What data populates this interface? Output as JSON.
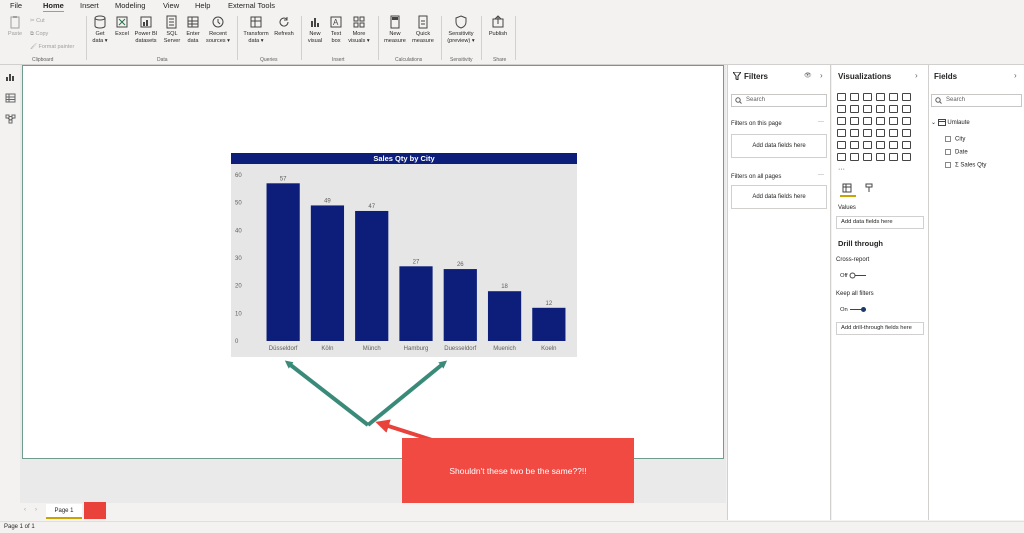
{
  "menu": {
    "tabs": [
      "File",
      "Home",
      "Insert",
      "Modeling",
      "View",
      "Help",
      "External Tools"
    ]
  },
  "ribbon": {
    "paste": "Paste",
    "cut": "Cut",
    "copy": "Copy",
    "format_painter": "Format painter",
    "get_data": "Get data",
    "excel": "Excel",
    "power_bi_datasets": "Power BI datasets",
    "sql_server": "SQL Server",
    "enter_data": "Enter data",
    "recent_sources": "Recent sources",
    "transform_data": "Transform data",
    "refresh": "Refresh",
    "new_visual": "New visual",
    "text_box": "Text box",
    "more_visuals": "More visuals",
    "new_measure": "New measure",
    "quick_measure": "Quick measure",
    "sensitivity": "Sensitivity (preview)",
    "publish": "Publish",
    "groups": {
      "clipboard": "Clipboard",
      "data": "Data",
      "queries": "Queries",
      "insert": "Insert",
      "calculations": "Calculations",
      "sensitivity": "Sensitivity",
      "share": "Share"
    }
  },
  "chart_data": {
    "type": "bar",
    "title": "Sales Qty by City",
    "categories": [
      "Düsseldorf",
      "Köln",
      "Münch",
      "Hamburg",
      "Duesseldorf",
      "Muenich",
      "Koeln"
    ],
    "values": [
      57,
      49,
      47,
      27,
      26,
      18,
      12
    ],
    "ylim": [
      0,
      60
    ],
    "yticks": [
      0,
      10,
      20,
      30,
      40,
      50,
      60
    ],
    "bar_color": "#0c1e7a",
    "xlabel": "",
    "ylabel": ""
  },
  "callout": {
    "text": "Shouldn't these two be the same??!!"
  },
  "pages": {
    "tab": "Page 1",
    "status": "Page 1 of 1"
  },
  "filters": {
    "title": "Filters",
    "search_placeholder": "Search",
    "on_this_page": "Filters on this page",
    "on_all_pages": "Filters on all pages",
    "add_fields": "Add data fields here"
  },
  "visualizations": {
    "title": "Visualizations",
    "values_label": "Values",
    "add_fields": "Add data fields here",
    "drill_through": "Drill through",
    "cross_report": "Cross-report",
    "cross_report_state": "Off",
    "keep_all_filters": "Keep all filters",
    "keep_all_filters_state": "On",
    "add_drill_fields": "Add drill-through fields here"
  },
  "fields": {
    "title": "Fields",
    "search_placeholder": "Search",
    "table_name": "Umlaute",
    "items": [
      "City",
      "Date",
      "Sales Qty"
    ]
  },
  "colors": {
    "accent": "#c8a400",
    "bar": "#0c1e7a",
    "callout": "#f04a43",
    "arrow_green": "#3a8a7a",
    "arrow_red": "#e8423b"
  }
}
